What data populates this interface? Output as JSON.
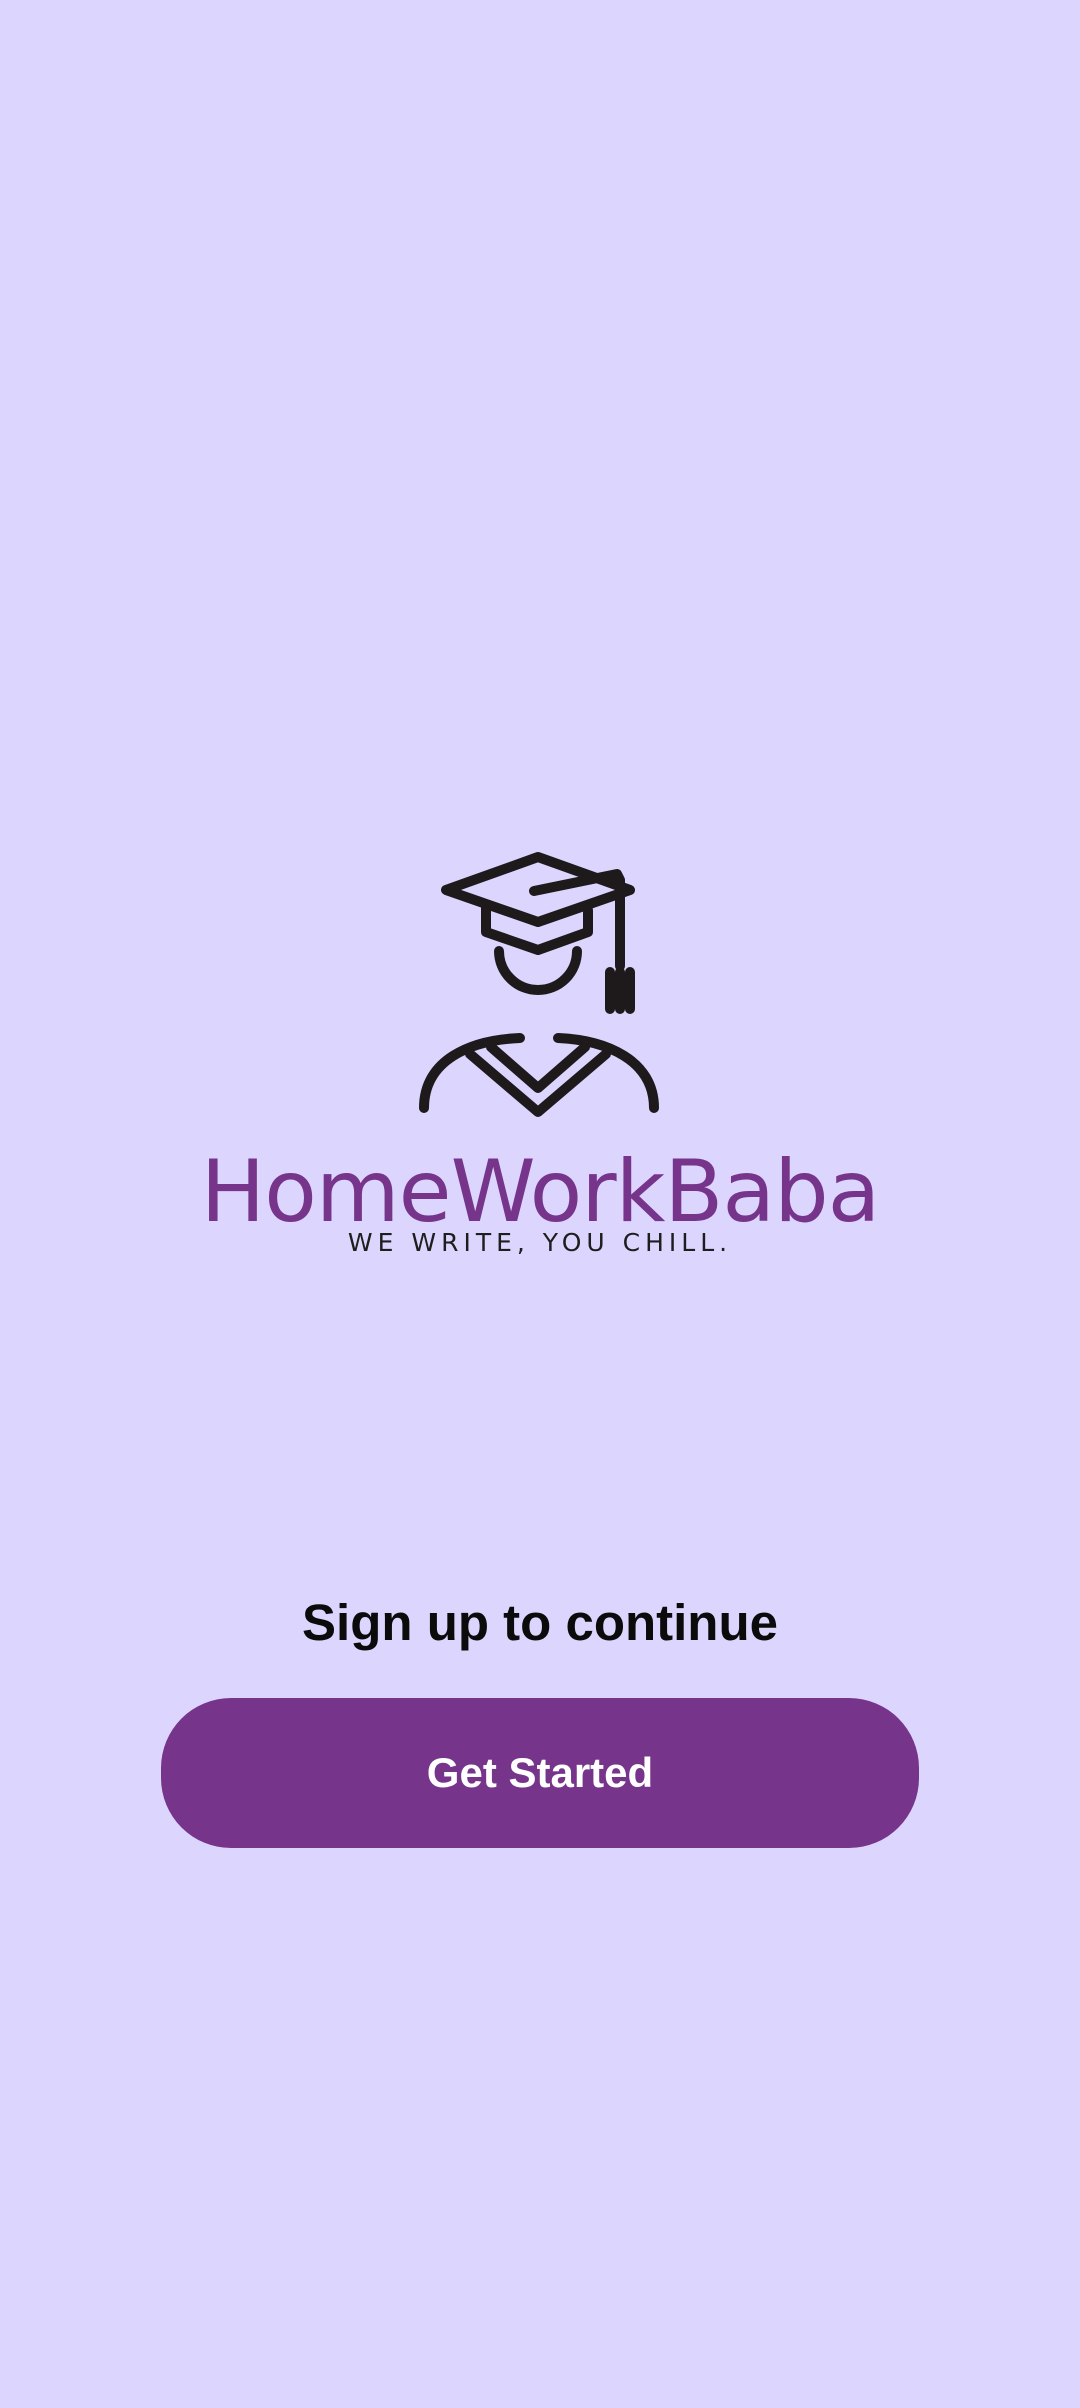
{
  "brand": {
    "name": "HomeWorkBaba",
    "tagline": "WE WRITE, YOU CHILL.",
    "logo_icon": "graduate-icon",
    "brand_color": "#76358B"
  },
  "signup": {
    "heading": "Sign up to continue",
    "cta_label": "Get Started"
  },
  "theme": {
    "background": "#DCD5FE",
    "accent": "#76358B"
  }
}
